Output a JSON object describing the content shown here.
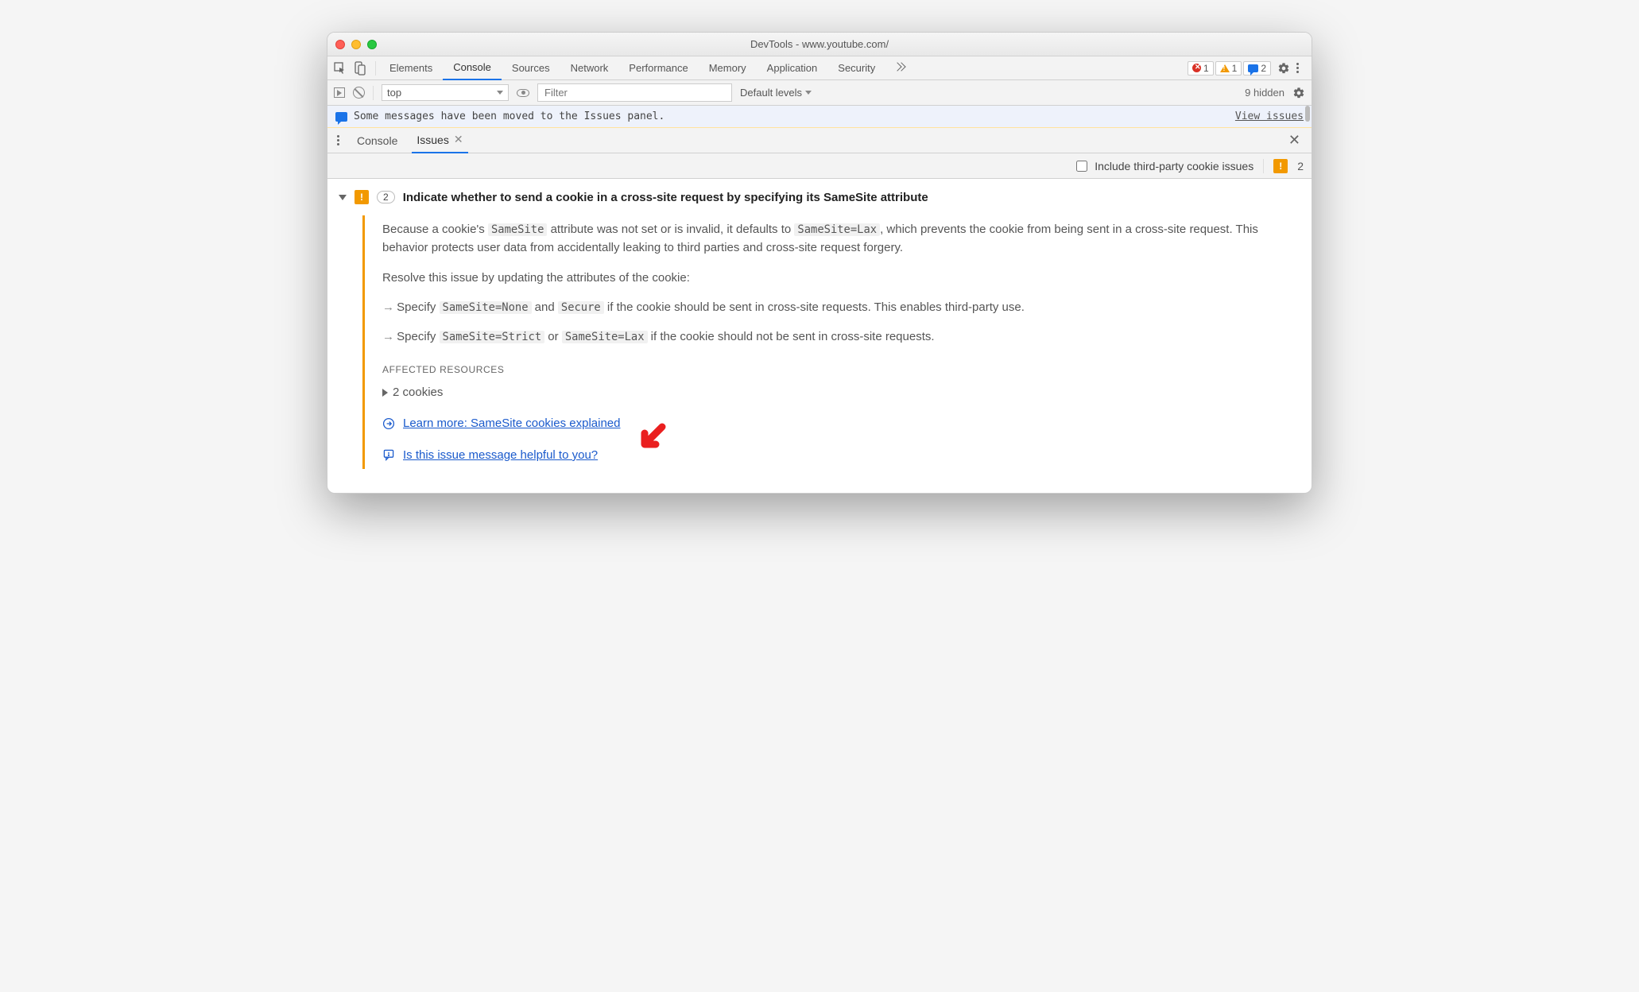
{
  "window": {
    "title": "DevTools - www.youtube.com/"
  },
  "mainTabs": {
    "items": [
      "Elements",
      "Console",
      "Sources",
      "Network",
      "Performance",
      "Memory",
      "Application",
      "Security"
    ],
    "active": "Console"
  },
  "statusBadges": {
    "error": "1",
    "warning": "1",
    "info": "2"
  },
  "consoleToolbar": {
    "context": "top",
    "filterPlaceholder": "Filter",
    "levels": "Default levels",
    "hidden": "9 hidden"
  },
  "infoBar": {
    "message": "Some messages have been moved to the Issues panel.",
    "link": "View issues"
  },
  "drawer": {
    "tabs": {
      "console": "Console",
      "issues": "Issues"
    },
    "active": "Issues"
  },
  "issuesToolbar": {
    "checkbox": "Include third-party cookie issues",
    "count": "2"
  },
  "issue": {
    "count": "2",
    "title": "Indicate whether to send a cookie in a cross-site request by specifying its SameSite attribute",
    "p1a": "Because a cookie's ",
    "p1b": " attribute was not set or is invalid, it defaults to ",
    "p1c": ", which prevents the cookie from being sent in a cross-site request. This behavior protects user data from accidentally leaking to third parties and cross-site request forgery.",
    "p2": "Resolve this issue by updating the attributes of the cookie:",
    "b1a": "Specify ",
    "b1b": " and ",
    "b1c": " if the cookie should be sent in cross-site requests. This enables third-party use.",
    "b2a": "Specify ",
    "b2b": " or ",
    "b2c": " if the cookie should not be sent in cross-site requests.",
    "code": {
      "samesite": "SameSite",
      "lax": "SameSite=Lax",
      "none": "SameSite=None",
      "secure": "Secure",
      "strict": "SameSite=Strict"
    },
    "affectedLabel": "AFFECTED RESOURCES",
    "cookies": "2 cookies",
    "learnMore": "Learn more: SameSite cookies explained",
    "feedback": "Is this issue message helpful to you?"
  }
}
